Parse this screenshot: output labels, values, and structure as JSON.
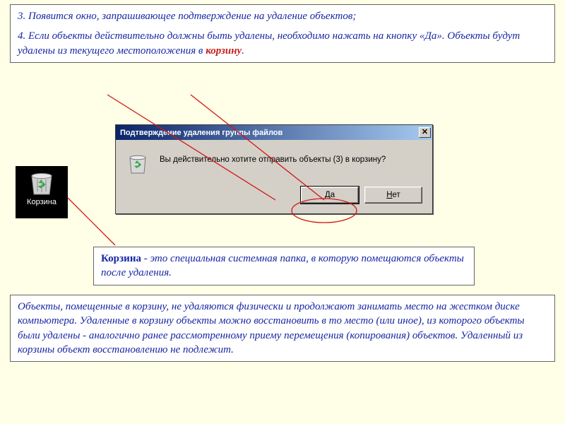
{
  "box1": {
    "step3": "3. Появится окно, запрашивающее подтверждение на удаление объектов;",
    "step4_a": "4. Если объекты действительно должны быть удалены, необходимо нажать на кнопку «Да». Объекты будут удалены из текущего местоположения в ",
    "step4_b": "корзину",
    "step4_c": "."
  },
  "desk_icon_label": "Корзина",
  "dialog": {
    "title": "Подтверждение удаления группы файлов",
    "close": "✕",
    "message": "Вы действительно хотите отправить объекты (3) в корзину?",
    "yes_pre": "Д",
    "yes_post": "а",
    "no_pre": "Н",
    "no_post": "ет"
  },
  "box2": {
    "lead": "Корзина",
    "rest": " - это специальная системная папка, в которую помещаются объекты после удаления."
  },
  "box3": {
    "text": "Объекты, помещенные в корзину, не удаляются  физически и продолжают занимать место на жестком диске компьютера. Удаленные в корзину объекты можно восстановить в то место (или иное), из которого объекты были удалены - аналогично ранее рассмотренному приему перемещения (копирования) объектов. Удаленный из корзины объект восстановлению не подлежит."
  }
}
